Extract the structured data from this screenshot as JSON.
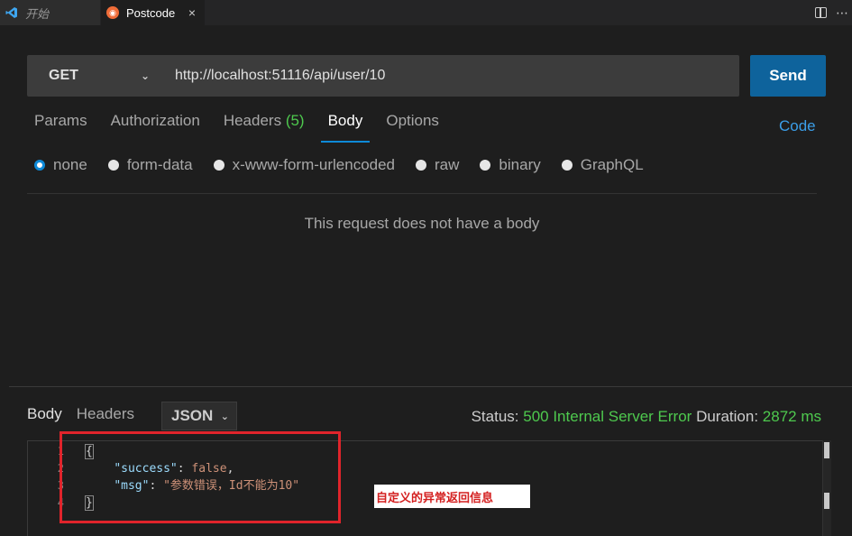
{
  "tabs": [
    {
      "label": "开始",
      "active": false
    },
    {
      "label": "Postcode",
      "active": true
    }
  ],
  "tab_close_glyph": "×",
  "request": {
    "method": "GET",
    "url": "http://localhost:51116/api/user/10",
    "send_label": "Send"
  },
  "request_tabs": {
    "params": "Params",
    "authorization": "Authorization",
    "headers": "Headers",
    "headers_count": "(5)",
    "body": "Body",
    "options": "Options"
  },
  "code_label": "Code",
  "body_types": [
    "none",
    "form-data",
    "x-www-form-urlencoded",
    "raw",
    "binary",
    "GraphQL"
  ],
  "selected_body_type": "none",
  "no_body_message": "This request does not have a body",
  "response": {
    "tab_body": "Body",
    "tab_headers": "Headers",
    "format": "JSON",
    "status_label": "Status:",
    "status_value": "500 Internal Server Error",
    "duration_label": "Duration:",
    "duration_value": "2872 ms",
    "line_numbers": [
      "1",
      "2",
      "3",
      "4"
    ],
    "code": {
      "open": "{",
      "key1": "\"success\"",
      "val1": "false",
      "key2": "\"msg\"",
      "val2": "\"参数错误，Id不能为10\"",
      "close": "}"
    }
  },
  "annotation": "自定义的异常返回信息",
  "colors": {
    "accent_blue": "#0e639c",
    "status_green": "#4ec94e",
    "annotation_red": "#e0242b"
  }
}
